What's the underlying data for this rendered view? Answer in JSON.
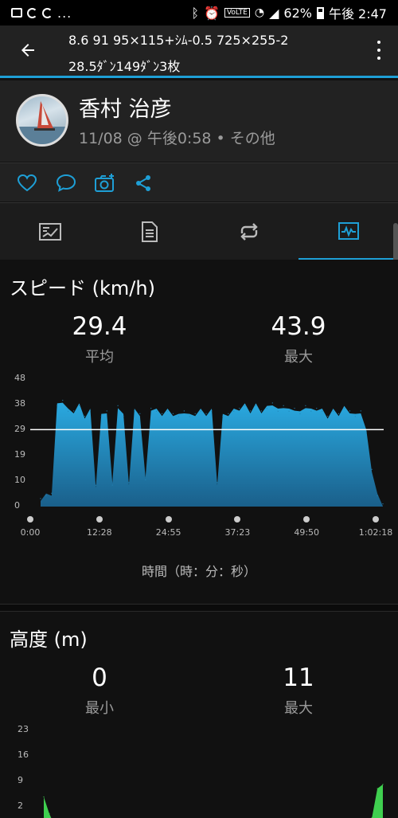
{
  "status_bar": {
    "battery": "62%",
    "time": "午後 2:47",
    "icons": [
      "gallery-icon",
      "sync-icon",
      "sync-icon",
      "more-icon",
      "bluetooth-icon",
      "alarm-icon",
      "volte-icon",
      "wifi-icon",
      "signal-icon",
      "battery-icon"
    ],
    "dots": "..."
  },
  "app_bar": {
    "title_line1": "8.6 91 95×115+ｼﾑ-0.5 725×255-2",
    "title_line2": "28.5ﾀﾞﾝ149ﾀﾞﾝ3枚"
  },
  "profile": {
    "name": "香村 治彦",
    "meta": "11/08 @ 午後0:58 • その他"
  },
  "actions": [
    "like-icon",
    "comment-icon",
    "add-photo-icon",
    "share-icon"
  ],
  "tabs": [
    {
      "icon": "summary-icon",
      "active": false
    },
    {
      "icon": "details-icon",
      "active": false
    },
    {
      "icon": "laps-icon",
      "active": false
    },
    {
      "icon": "charts-icon",
      "active": true
    }
  ],
  "speed": {
    "title": "スピード (km/h)",
    "avg_value": "29.4",
    "avg_label": "平均",
    "max_value": "43.9",
    "max_label": "最大",
    "x_axis_title": "時間（時：分：秒）"
  },
  "altitude": {
    "title": "高度 (m)",
    "min_value": "0",
    "min_label": "最小",
    "max_value": "11",
    "max_label": "最大"
  },
  "colors": {
    "accent": "#1e9fd6",
    "speed_fill_top": "#2aa9e0",
    "speed_fill_bottom": "#1a5f8a",
    "altitude_fill": "#3fcf4f",
    "avg_line": "#ffffff"
  },
  "chart_data": [
    {
      "type": "area",
      "title": "スピード (km/h)",
      "xlabel": "時間（時：分：秒）",
      "ylabel": "",
      "y_ticks": [
        "48",
        "38",
        "29",
        "19",
        "10",
        "0"
      ],
      "x_ticks": [
        "0:00",
        "12:28",
        "24:55",
        "37:23",
        "49:50",
        "1:02:18"
      ],
      "ylim": [
        0,
        48
      ],
      "average_line": 29,
      "x_minutes": [
        0,
        1,
        2,
        3,
        4,
        5,
        6,
        7,
        8,
        9,
        10,
        11,
        12,
        13,
        14,
        15,
        16,
        17,
        18,
        19,
        20,
        21,
        22,
        23,
        24,
        25,
        26,
        27,
        28,
        29,
        30,
        31,
        32,
        33,
        34,
        35,
        36,
        37,
        38,
        39,
        40,
        41,
        42,
        43,
        44,
        45,
        46,
        47,
        48,
        49,
        50,
        51,
        52,
        53,
        54,
        55,
        56,
        57,
        58,
        59,
        60,
        61,
        62
      ],
      "values": [
        3,
        4,
        5,
        38,
        40,
        36,
        36,
        38,
        34,
        36,
        8,
        34,
        36,
        8,
        38,
        34,
        9,
        36,
        35,
        10,
        37,
        36,
        35,
        36,
        35,
        34,
        36,
        34,
        35,
        36,
        35,
        36,
        9,
        34,
        35,
        36,
        37,
        38,
        36,
        38,
        36,
        37,
        39,
        36,
        38,
        36,
        37,
        35,
        38,
        36,
        37,
        36,
        34,
        36,
        35,
        37,
        36,
        34,
        36,
        28,
        14,
        4,
        1
      ],
      "grid": false
    },
    {
      "type": "area",
      "title": "高度 (m)",
      "y_ticks": [
        "23",
        "16",
        "9",
        "2"
      ],
      "ylim": [
        0,
        23
      ],
      "x_minutes": [
        0,
        1,
        2,
        30,
        59,
        60,
        61,
        62
      ],
      "values": [
        7,
        3,
        0,
        0,
        0,
        2,
        9,
        10
      ],
      "grid": false
    }
  ]
}
